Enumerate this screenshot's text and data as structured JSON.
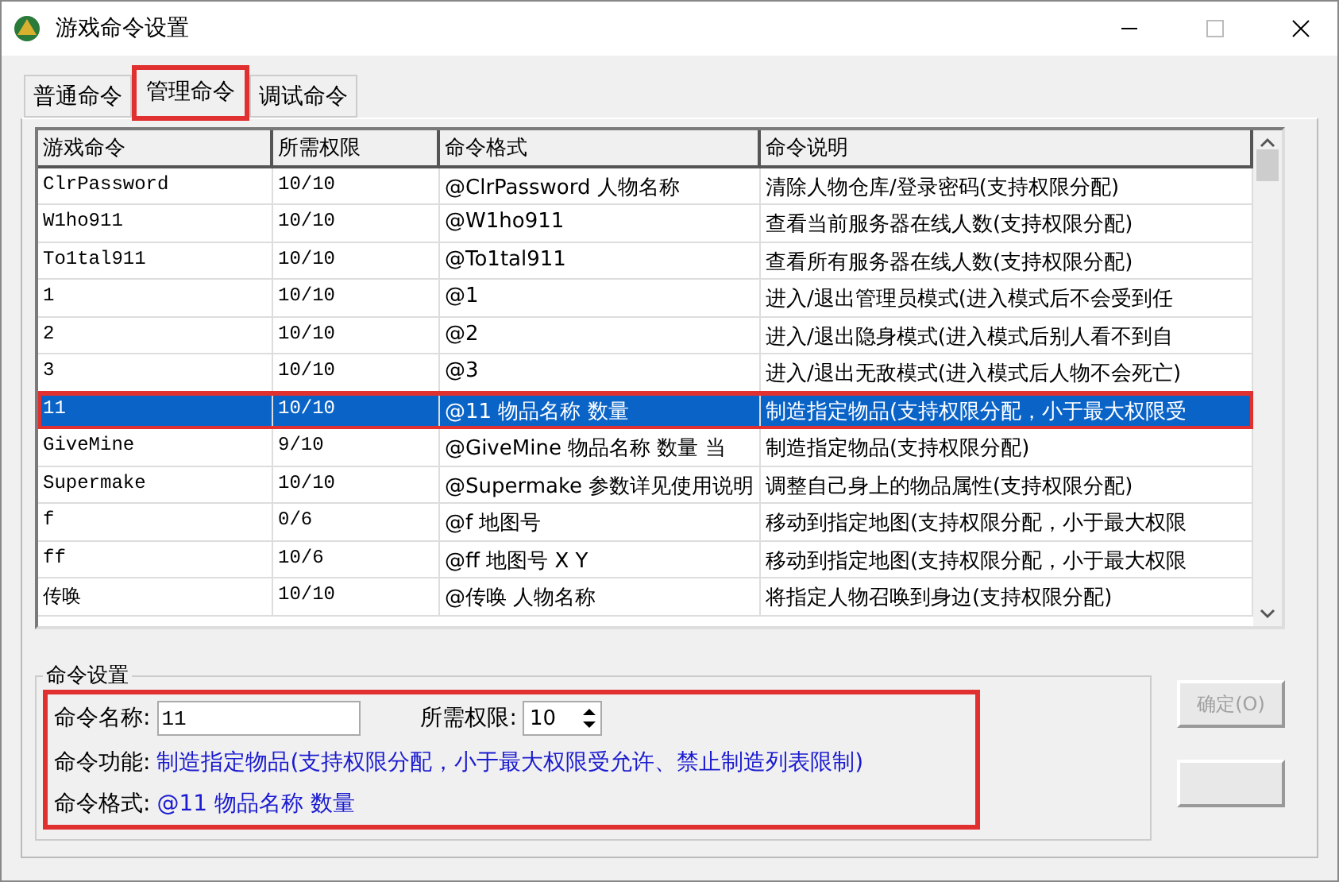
{
  "window": {
    "title": "游戏命令设置"
  },
  "tabs": [
    {
      "label": "普通命令",
      "selected": false,
      "annotated": false
    },
    {
      "label": "管理命令",
      "selected": true,
      "annotated": true
    },
    {
      "label": "调试命令",
      "selected": false,
      "annotated": false
    }
  ],
  "table": {
    "columns": [
      "游戏命令",
      "所需权限",
      "命令格式",
      "命令说明"
    ],
    "rows": [
      {
        "cells": [
          "ClrPassword",
          "10/10",
          "@ClrPassword 人物名称",
          "清除人物仓库/登录密码(支持权限分配)"
        ],
        "selected": false
      },
      {
        "cells": [
          "W1ho911",
          "10/10",
          "@W1ho911",
          "查看当前服务器在线人数(支持权限分配)"
        ],
        "selected": false
      },
      {
        "cells": [
          "To1tal911",
          "10/10",
          "@To1tal911",
          "查看所有服务器在线人数(支持权限分配)"
        ],
        "selected": false
      },
      {
        "cells": [
          "1",
          "10/10",
          "@1",
          "进入/退出管理员模式(进入模式后不会受到任"
        ],
        "selected": false
      },
      {
        "cells": [
          "2",
          "10/10",
          "@2",
          "进入/退出隐身模式(进入模式后别人看不到自"
        ],
        "selected": false
      },
      {
        "cells": [
          "3",
          "10/10",
          "@3",
          "进入/退出无敌模式(进入模式后人物不会死亡)"
        ],
        "selected": false
      },
      {
        "cells": [
          "11",
          "10/10",
          "@11 物品名称 数量",
          "制造指定物品(支持权限分配，小于最大权限受"
        ],
        "selected": true
      },
      {
        "cells": [
          "GiveMine",
          "9/10",
          "@GiveMine 物品名称 数量 当",
          "制造指定物品(支持权限分配)"
        ],
        "selected": false
      },
      {
        "cells": [
          "Supermake",
          "10/10",
          "@Supermake 参数详见使用说明",
          "调整自己身上的物品属性(支持权限分配)"
        ],
        "selected": false
      },
      {
        "cells": [
          "f",
          "0/6",
          "@f 地图号",
          "移动到指定地图(支持权限分配，小于最大权限"
        ],
        "selected": false
      },
      {
        "cells": [
          "ff",
          "10/6",
          "@ff 地图号 X Y",
          "移动到指定地图(支持权限分配，小于最大权限"
        ],
        "selected": false
      },
      {
        "cells": [
          "传唤",
          "10/10",
          "@传唤 人物名称",
          "将指定人物召唤到身边(支持权限分配)"
        ],
        "selected": false
      }
    ]
  },
  "settings": {
    "title": "命令设置",
    "annotated": true,
    "name_label": "命令名称:",
    "name_value": "11",
    "level_label": "所需权限:",
    "level_value": "10",
    "function_label": "命令功能:",
    "function_text": "制造指定物品(支持权限分配，小于最大权限受允许、禁止制造列表限制)",
    "format_label": "命令格式:",
    "format_text": "@11 物品名称 数量"
  },
  "buttons": [
    {
      "label": "确定(O)",
      "disabled": true
    }
  ]
}
